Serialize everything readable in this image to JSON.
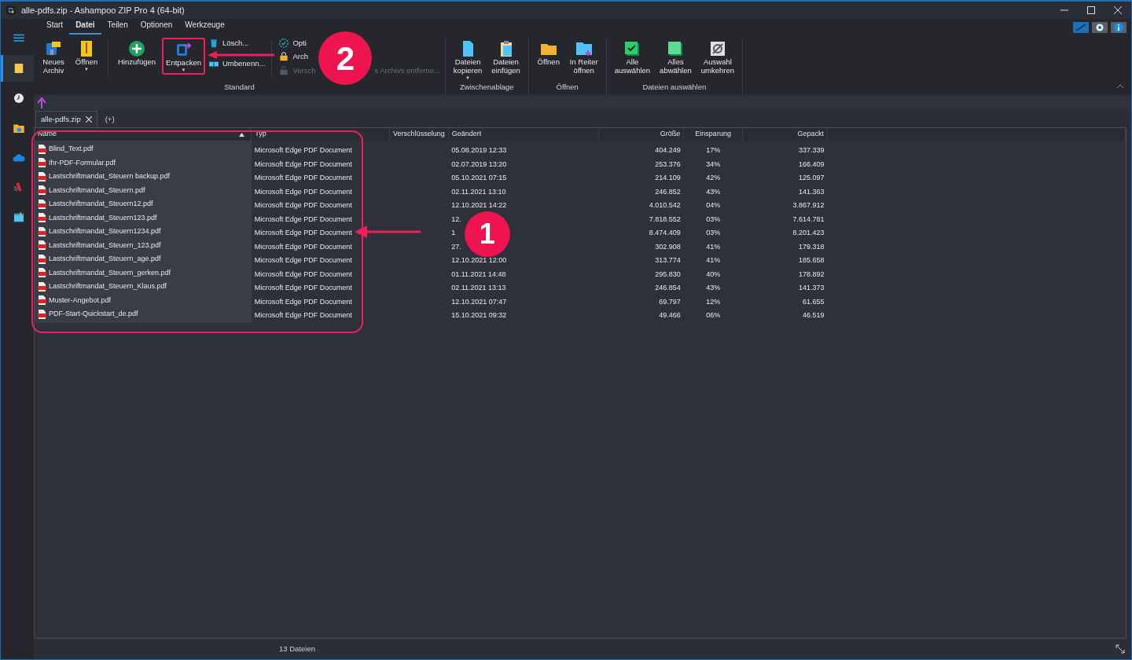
{
  "window": {
    "title": "alle-pdfs.zip - Ashampoo ZIP Pro 4 (64-bit)"
  },
  "sidebar": {
    "items": [
      {
        "selected": false
      },
      {
        "selected": true
      },
      {
        "selected": false
      },
      {
        "selected": false
      },
      {
        "selected": false
      },
      {
        "selected": false
      },
      {
        "selected": false
      }
    ]
  },
  "ribbon": {
    "tabs": [
      {
        "label": "Start",
        "selected": false
      },
      {
        "label": "Datei",
        "selected": true
      },
      {
        "label": "Teilen",
        "selected": false
      },
      {
        "label": "Optionen",
        "selected": false
      },
      {
        "label": "Werkzeuge",
        "selected": false
      }
    ],
    "groups": [
      {
        "label": "Standard",
        "items": [
          {
            "kind": "large",
            "label": "Neues\nArchiv",
            "outlined": false
          },
          {
            "kind": "large",
            "label": "Öffnen",
            "caret": "▼",
            "outlined": false
          },
          {
            "kind": "separator"
          },
          {
            "kind": "large",
            "label": "Hinzufügen",
            "outlined": false
          },
          {
            "kind": "large",
            "label": "Entpacken",
            "caret": "▼",
            "outlined": true
          },
          {
            "kind": "stack",
            "items": [
              {
                "label": "Lösch...",
                "disabled": false
              },
              {
                "label": "Umbenenn...",
                "disabled": false
              }
            ]
          },
          {
            "kind": "separator"
          },
          {
            "kind": "stack",
            "items": [
              {
                "label": "Opti",
                "disabled": false
              },
              {
                "label": "Arch",
                "disabled": false
              },
              {
                "label": "Versch",
                "disabled": true
              },
              {
                "label": "s Archivs entferne...",
                "disabled": true
              }
            ]
          }
        ]
      },
      {
        "label": "Zwischenablage",
        "items": [
          {
            "kind": "large",
            "label": "Dateien\nkopieren",
            "caret": "▼",
            "outlined": false
          },
          {
            "kind": "large",
            "label": "Dateien\neinfügen",
            "outlined": false
          }
        ]
      },
      {
        "label": "Öffnen",
        "items": [
          {
            "kind": "large",
            "label": "Öffnen",
            "outlined": false
          },
          {
            "kind": "large",
            "label": "In Reiter\nöffnen",
            "outlined": false
          }
        ]
      },
      {
        "label": "Dateien auswählen",
        "items": [
          {
            "kind": "large",
            "label": "Alle\nauswählen",
            "outlined": false
          },
          {
            "kind": "large",
            "label": "Alles\nabwählen",
            "outlined": false
          },
          {
            "kind": "large",
            "label": "Auswahl\numkehren",
            "outlined": false
          }
        ]
      }
    ]
  },
  "doc_tabs": [
    {
      "label": "alle-pdfs.zip",
      "selected": true
    }
  ],
  "new_tab": "(+)",
  "table": {
    "columns": [
      {
        "label": "Name",
        "sorted": true
      },
      {
        "label": "Typ",
        "sorted": false
      },
      {
        "label": "Verschlüsselung",
        "sorted": false
      },
      {
        "label": "Geändert",
        "sorted": false
      },
      {
        "label": "Größe",
        "sorted": false
      },
      {
        "label": "Einsparung",
        "sorted": false
      },
      {
        "label": "Gepackt",
        "sorted": false
      }
    ],
    "rows": [
      {
        "name": "Blind_Text.pdf",
        "type": "Microsoft Edge PDF Document",
        "modified": "05.08.2019 12:33",
        "size": "404.249",
        "saving": "17%",
        "packed": "337.339"
      },
      {
        "name": "Ihr-PDF-Formular.pdf",
        "type": "Microsoft Edge PDF Document",
        "modified": "02.07.2019 13:20",
        "size": "253.376",
        "saving": "34%",
        "packed": "166.409"
      },
      {
        "name": "Lastschriftmandat_Steuern backup.pdf",
        "type": "Microsoft Edge PDF Document",
        "modified": "05.10.2021 07:15",
        "size": "214.109",
        "saving": "42%",
        "packed": "125.097"
      },
      {
        "name": "Lastschriftmandat_Steuern.pdf",
        "type": "Microsoft Edge PDF Document",
        "modified": "02.11.2021 13:10",
        "size": "246.852",
        "saving": "43%",
        "packed": "141.363"
      },
      {
        "name": "Lastschriftmandat_Steuern12.pdf",
        "type": "Microsoft Edge PDF Document",
        "modified": "12.10.2021 14:22",
        "size": "4.010.542",
        "saving": "04%",
        "packed": "3.867.912"
      },
      {
        "name": "Lastschriftmandat_Steuern123.pdf",
        "type": "Microsoft Edge PDF Document",
        "modified": "12.",
        "size": "7.818.552",
        "saving": "03%",
        "packed": "7.614.781"
      },
      {
        "name": "Lastschriftmandat_Steuern1234.pdf",
        "type": "Microsoft Edge PDF Document",
        "modified": "1",
        "size": "8.474.409",
        "saving": "03%",
        "packed": "8.201.423"
      },
      {
        "name": "Lastschriftmandat_Steuern_123.pdf",
        "type": "Microsoft Edge PDF Document",
        "modified": "27.",
        "size": "302.908",
        "saving": "41%",
        "packed": "179.318"
      },
      {
        "name": "Lastschriftmandat_Steuern_age.pdf",
        "type": "Microsoft Edge PDF Document",
        "modified": "12.10.2021 12:00",
        "size": "313.774",
        "saving": "41%",
        "packed": "185.658"
      },
      {
        "name": "Lastschriftmandat_Steuern_gerken.pdf",
        "type": "Microsoft Edge PDF Document",
        "modified": "01.11.2021 14:48",
        "size": "295.830",
        "saving": "40%",
        "packed": "178.892"
      },
      {
        "name": "Lastschriftmandat_Steuern_Klaus.pdf",
        "type": "Microsoft Edge PDF Document",
        "modified": "02.11.2021 13:13",
        "size": "246.854",
        "saving": "43%",
        "packed": "141.373"
      },
      {
        "name": "Muster-Angebot.pdf",
        "type": "Microsoft Edge PDF Document",
        "modified": "12.10.2021 07:47",
        "size": "69.797",
        "saving": "12%",
        "packed": "61.655"
      },
      {
        "name": "PDF-Start-Quickstart_de.pdf",
        "type": "Microsoft Edge PDF Document",
        "modified": "15.10.2021 09:32",
        "size": "49.466",
        "saving": "06%",
        "packed": "46.519"
      }
    ]
  },
  "status_bar": {
    "count": "13 Dateien"
  },
  "annotations": [
    {
      "label": "1"
    },
    {
      "label": "2"
    }
  ]
}
